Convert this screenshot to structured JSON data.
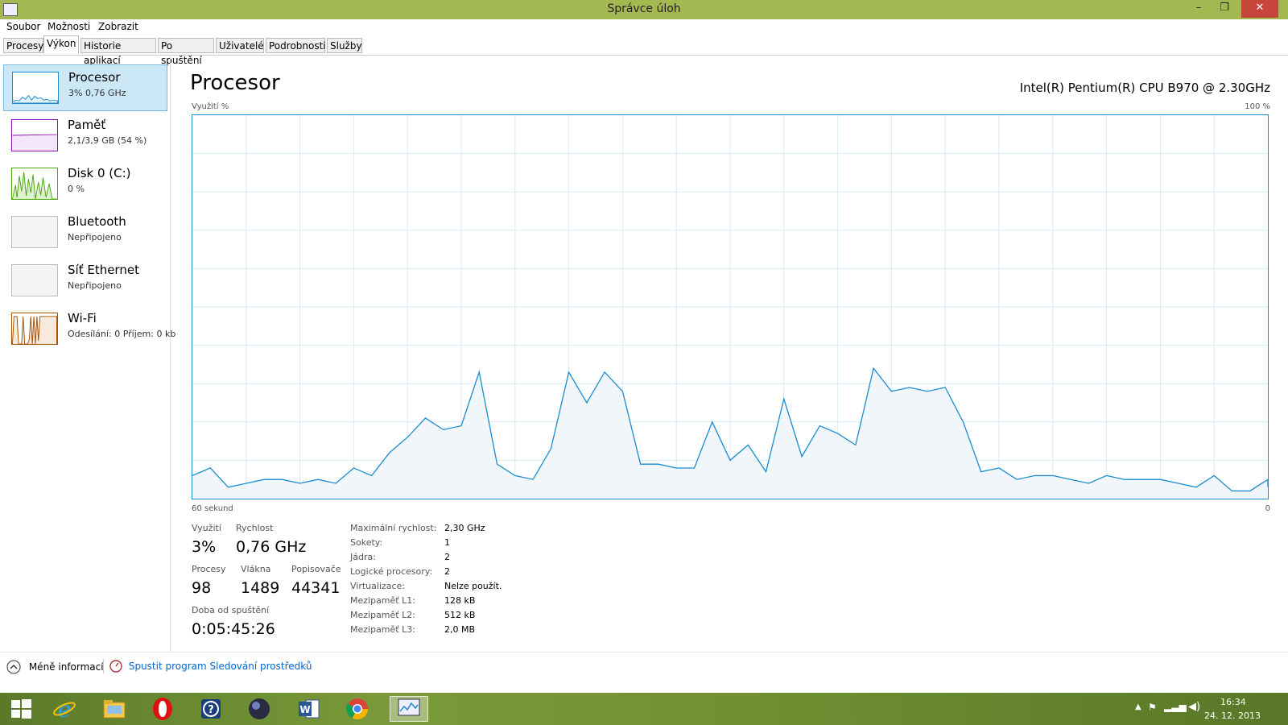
{
  "window": {
    "title": "Správce úloh",
    "minimize": "–",
    "restore": "❐",
    "close": "✕"
  },
  "menu": [
    "Soubor",
    "Možnosti",
    "Zobrazit"
  ],
  "tabs": [
    "Procesy",
    "Výkon",
    "Historie aplikací",
    "Po spuštění",
    "Uživatelé",
    "Podrobnosti",
    "Služby"
  ],
  "sidebar": [
    {
      "name": "Procesor",
      "sub": "3% 0,76 GHz",
      "color": "#1a8ccf",
      "icon": "cpu-graph-icon"
    },
    {
      "name": "Paměť",
      "sub": "2,1/3,9 GB (54 %)",
      "color": "#8b12ae",
      "icon": "memory-graph-icon"
    },
    {
      "name": "Disk 0 (C:)",
      "sub": "0 %",
      "color": "#4da60c",
      "icon": "disk-graph-icon"
    },
    {
      "name": "Bluetooth",
      "sub": "Nepřipojeno",
      "color": "#bbbbbb",
      "icon": "bluetooth-graph-icon"
    },
    {
      "name": "Síť Ethernet",
      "sub": "Nepřipojeno",
      "color": "#bbbbbb",
      "icon": "ethernet-graph-icon"
    },
    {
      "name": "Wi-Fi",
      "sub": "Odesílání: 0 Příjem: 0 kb",
      "color": "#a74f01",
      "icon": "wifi-graph-icon"
    }
  ],
  "main": {
    "title": "Procesor",
    "cpu_model": "Intel(R) Pentium(R) CPU B970 @ 2.30GHz",
    "y_label": "Využití %",
    "y_max_label": "100 %",
    "x_left_label": "60 sekund",
    "x_right_label": "0"
  },
  "chart_data": {
    "type": "area",
    "ylabel": "Využití %",
    "xlabel": "60 sekund",
    "ylim": [
      0,
      100
    ],
    "xlim": [
      60,
      0
    ],
    "x": [
      60,
      59,
      58,
      57,
      56,
      55,
      54,
      53,
      52,
      51,
      50,
      49,
      48,
      47,
      46,
      45,
      44,
      43,
      42,
      41,
      40,
      39,
      38,
      37,
      36,
      35,
      34,
      33,
      32,
      31,
      30,
      29,
      28,
      27,
      26,
      25,
      24,
      23,
      22,
      21,
      20,
      19,
      18,
      17,
      16,
      15,
      14,
      13,
      12,
      11,
      10,
      9,
      8,
      7,
      6,
      5,
      4,
      3,
      2,
      1,
      0
    ],
    "values": [
      6,
      8,
      3,
      4,
      5,
      5,
      4,
      5,
      4,
      8,
      6,
      12,
      16,
      21,
      18,
      19,
      33,
      9,
      6,
      5,
      13,
      33,
      25,
      33,
      28,
      9,
      9,
      8,
      8,
      20,
      10,
      14,
      7,
      26,
      11,
      19,
      17,
      14,
      34,
      28,
      29,
      28,
      29,
      20,
      7,
      8,
      5,
      6,
      6,
      5,
      4,
      6,
      5,
      5,
      5,
      4,
      3,
      6,
      2,
      2,
      5,
      3
    ]
  },
  "stats": {
    "utilization_label": "Využití",
    "utilization": "3%",
    "speed_label": "Rychlost",
    "speed": "0,76 GHz",
    "processes_label": "Procesy",
    "processes": "98",
    "threads_label": "Vlákna",
    "threads": "1489",
    "handles_label": "Popisovače",
    "handles": "44341",
    "uptime_label": "Doba od spuštění",
    "uptime": "0:05:45:26"
  },
  "specs": [
    {
      "label": "Maximální rychlost:",
      "value": "2,30 GHz"
    },
    {
      "label": "Sokety:",
      "value": "1"
    },
    {
      "label": "Jádra:",
      "value": "2"
    },
    {
      "label": "Logické procesory:",
      "value": "2"
    },
    {
      "label": "Virtualizace:",
      "value": "Nelze použít."
    },
    {
      "label": "Mezipaměť L1:",
      "value": "128 kB"
    },
    {
      "label": "Mezipaměť L2:",
      "value": "512 kB"
    },
    {
      "label": "Mezipaměť L3:",
      "value": "2,0 MB"
    }
  ],
  "footer": {
    "less_info": "Méně informací",
    "resource_monitor": "Spustit program Sledování prostředků"
  },
  "taskbar": {
    "apps": [
      "windows-start-icon",
      "internet-explorer-icon",
      "file-explorer-icon",
      "opera-icon",
      "help-icon",
      "media-player-icon",
      "word-icon",
      "chrome-icon",
      "task-manager-icon"
    ],
    "time": "16:34",
    "date": "24. 12. 2013"
  },
  "colors": {
    "accent": "#1a8ccf",
    "title_bar": "#a3b850",
    "selection": "#cce8f7",
    "link": "#0066cc"
  }
}
